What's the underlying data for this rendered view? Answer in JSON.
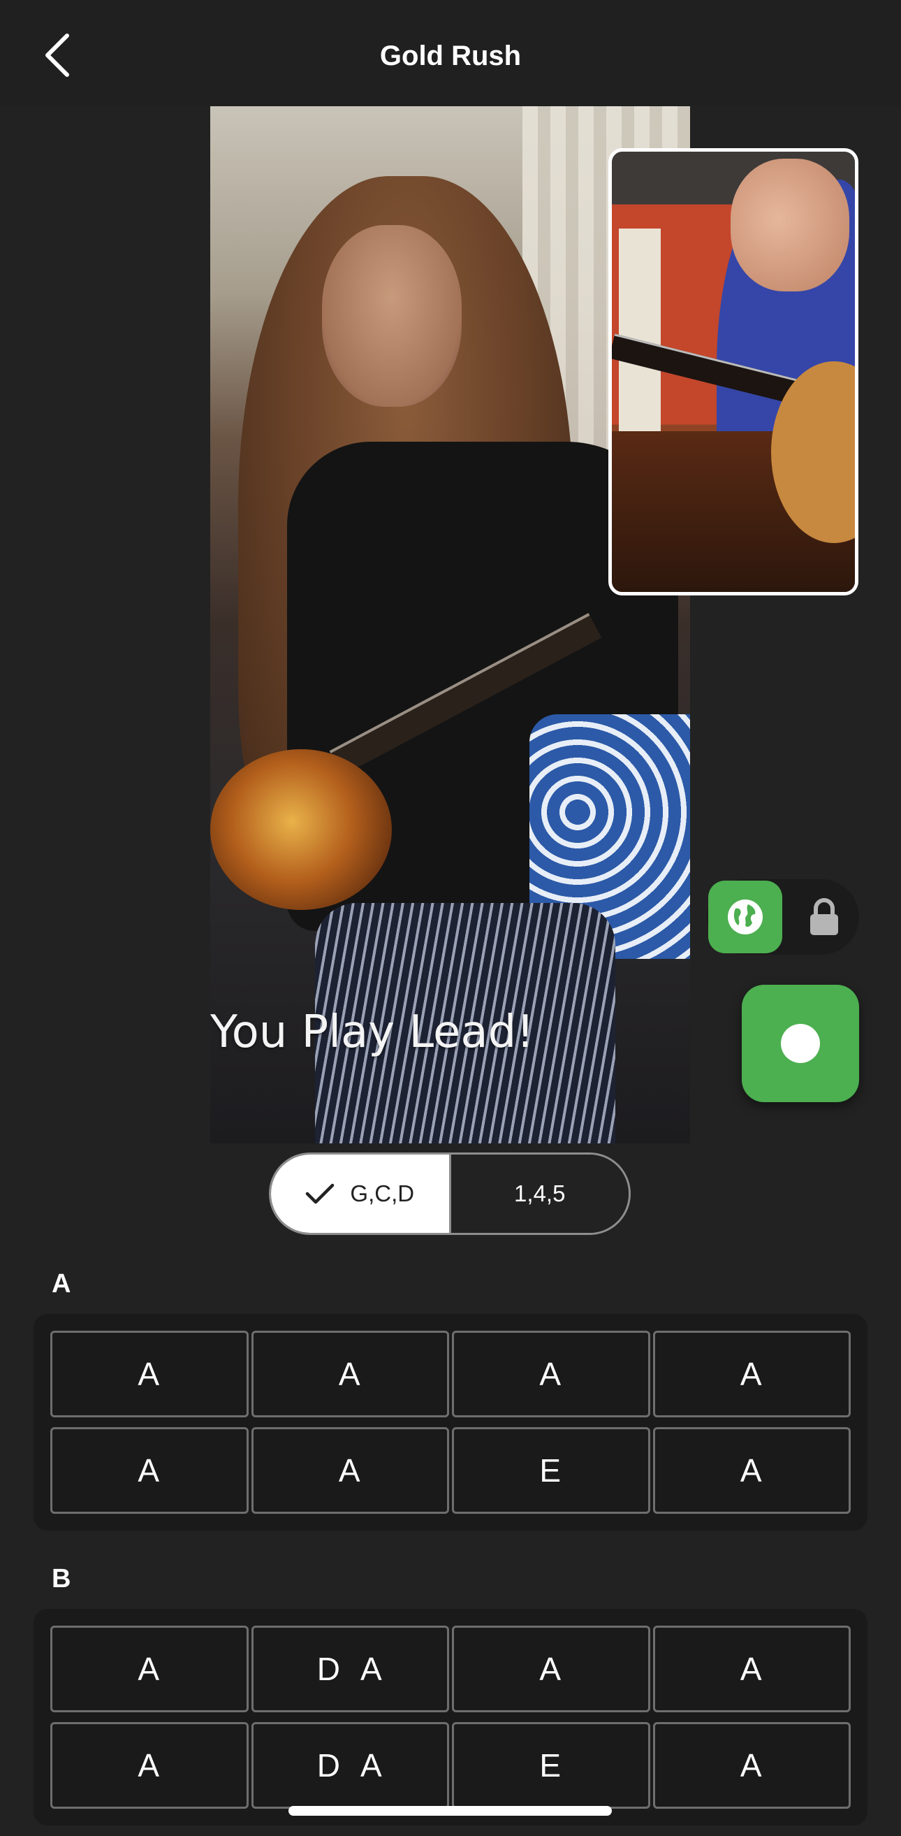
{
  "header": {
    "title": "Gold Rush",
    "back_icon": "chevron-left-icon"
  },
  "video": {
    "overlay_text": "You Play Lead!"
  },
  "visibility": {
    "public_icon": "globe-icon",
    "private_icon": "lock-icon",
    "selected": "public"
  },
  "record": {
    "icon": "record-icon"
  },
  "notation_toggle": {
    "options": [
      "G,C,D",
      "1,4,5"
    ],
    "selected_index": 0
  },
  "sections": [
    {
      "label": "A",
      "chords": [
        "A",
        "A",
        "A",
        "A",
        "A",
        "A",
        "E",
        "A"
      ]
    },
    {
      "label": "B",
      "chords": [
        "A",
        "D  A",
        "A",
        "A",
        "A",
        "D  A",
        "E",
        "A"
      ]
    }
  ],
  "colors": {
    "accent": "#4caf50",
    "background": "#222222",
    "header": "#1f201f",
    "card": "#1a1a1a"
  }
}
